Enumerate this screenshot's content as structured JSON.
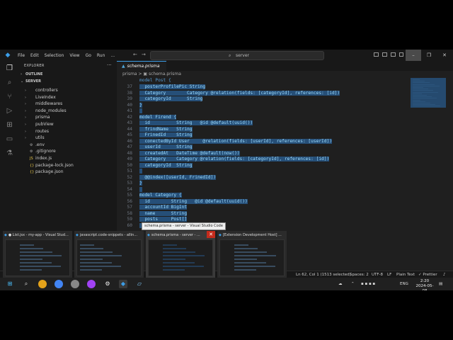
{
  "titlebar": {
    "menu": [
      "File",
      "Edit",
      "Selection",
      "View",
      "Go",
      "Run",
      "..."
    ],
    "search": "server",
    "minimize": "–",
    "maximize": "❐",
    "close": "✕"
  },
  "sidebar": {
    "title": "EXPLORER",
    "dots": "···",
    "outline": "OUTLINE",
    "root": "SERVER",
    "items": [
      {
        "label": "controllers",
        "type": "folder"
      },
      {
        "label": "LiveIndex",
        "type": "folder"
      },
      {
        "label": "middlewares",
        "type": "folder"
      },
      {
        "label": "node_modules",
        "type": "folder"
      },
      {
        "label": "prisma",
        "type": "folder"
      },
      {
        "label": "pubView",
        "type": "folder"
      },
      {
        "label": "routes",
        "type": "folder"
      },
      {
        "label": "utils",
        "type": "folder"
      },
      {
        "label": ".env",
        "type": "file"
      },
      {
        "label": ".gitignore",
        "type": "file"
      },
      {
        "label": "index.js",
        "type": "file"
      },
      {
        "label": "package-lock.json",
        "type": "file"
      },
      {
        "label": "package.json",
        "type": "file"
      }
    ]
  },
  "editor": {
    "tab": "schema.prisma",
    "breadcrumb": "prisma > ▣ schema.prisma",
    "header_line": "model Post {",
    "lines": [
      {
        "n": "37",
        "t": "  posterProfilePic String"
      },
      {
        "n": "38",
        "t": "  Category        Category @relation(fields: [categoryId], references: [id])"
      },
      {
        "n": "39",
        "t": "  categoryId      String"
      },
      {
        "n": "40",
        "t": "}"
      },
      {
        "n": "41",
        "t": ""
      },
      {
        "n": "42",
        "t": "model Firend {"
      },
      {
        "n": "43",
        "t": "  id          String   @id @default(uuid())"
      },
      {
        "n": "44",
        "t": "  frindName   String"
      },
      {
        "n": "45",
        "t": "  FrinedId    String"
      },
      {
        "n": "46",
        "t": "  conectedById User     @relation(fields: [userId], references: [userId])"
      },
      {
        "n": "47",
        "t": "  userId      String"
      },
      {
        "n": "48",
        "t": "  createdAt   DateTime @default(now())"
      },
      {
        "n": "49",
        "t": "  Category    Category @relation(fields: [categoryId], references: [id])"
      },
      {
        "n": "50",
        "t": "  categoryId  String"
      },
      {
        "n": "51",
        "t": ""
      },
      {
        "n": "52",
        "t": "  @@index([userId, FrinedId])"
      },
      {
        "n": "53",
        "t": "}"
      },
      {
        "n": "54",
        "t": ""
      },
      {
        "n": "55",
        "t": "model Category {"
      },
      {
        "n": "56",
        "t": "  id        String   @id @default(uuid())"
      },
      {
        "n": "57",
        "t": "  accountId BigInt"
      },
      {
        "n": "58",
        "t": "  name      String"
      },
      {
        "n": "59",
        "t": "  posts     Post[]"
      },
      {
        "n": "60",
        "t": ""
      }
    ]
  },
  "tooltip": "schema.prisma - server - Visual Studio Code",
  "thumbnails": [
    {
      "title": "● List.jsx - my-app - Visual Stud..."
    },
    {
      "title": "javascript.code-snippets - allin..."
    },
    {
      "title": "schema.prisma - server - ..."
    },
    {
      "title": "[Extension Development Host] ..."
    }
  ],
  "statusbar": {
    "position": "Ln 62, Col 1 (1513 selected)",
    "spaces": "Spaces: 2",
    "encoding": "UTF-8",
    "eol": "LF",
    "language": "Plain Text",
    "prettier": "✓ Prettier",
    "bell": "♪"
  },
  "taskbar": {
    "lang": "ENG",
    "time": "2:20",
    "date": "2024-05-08"
  }
}
